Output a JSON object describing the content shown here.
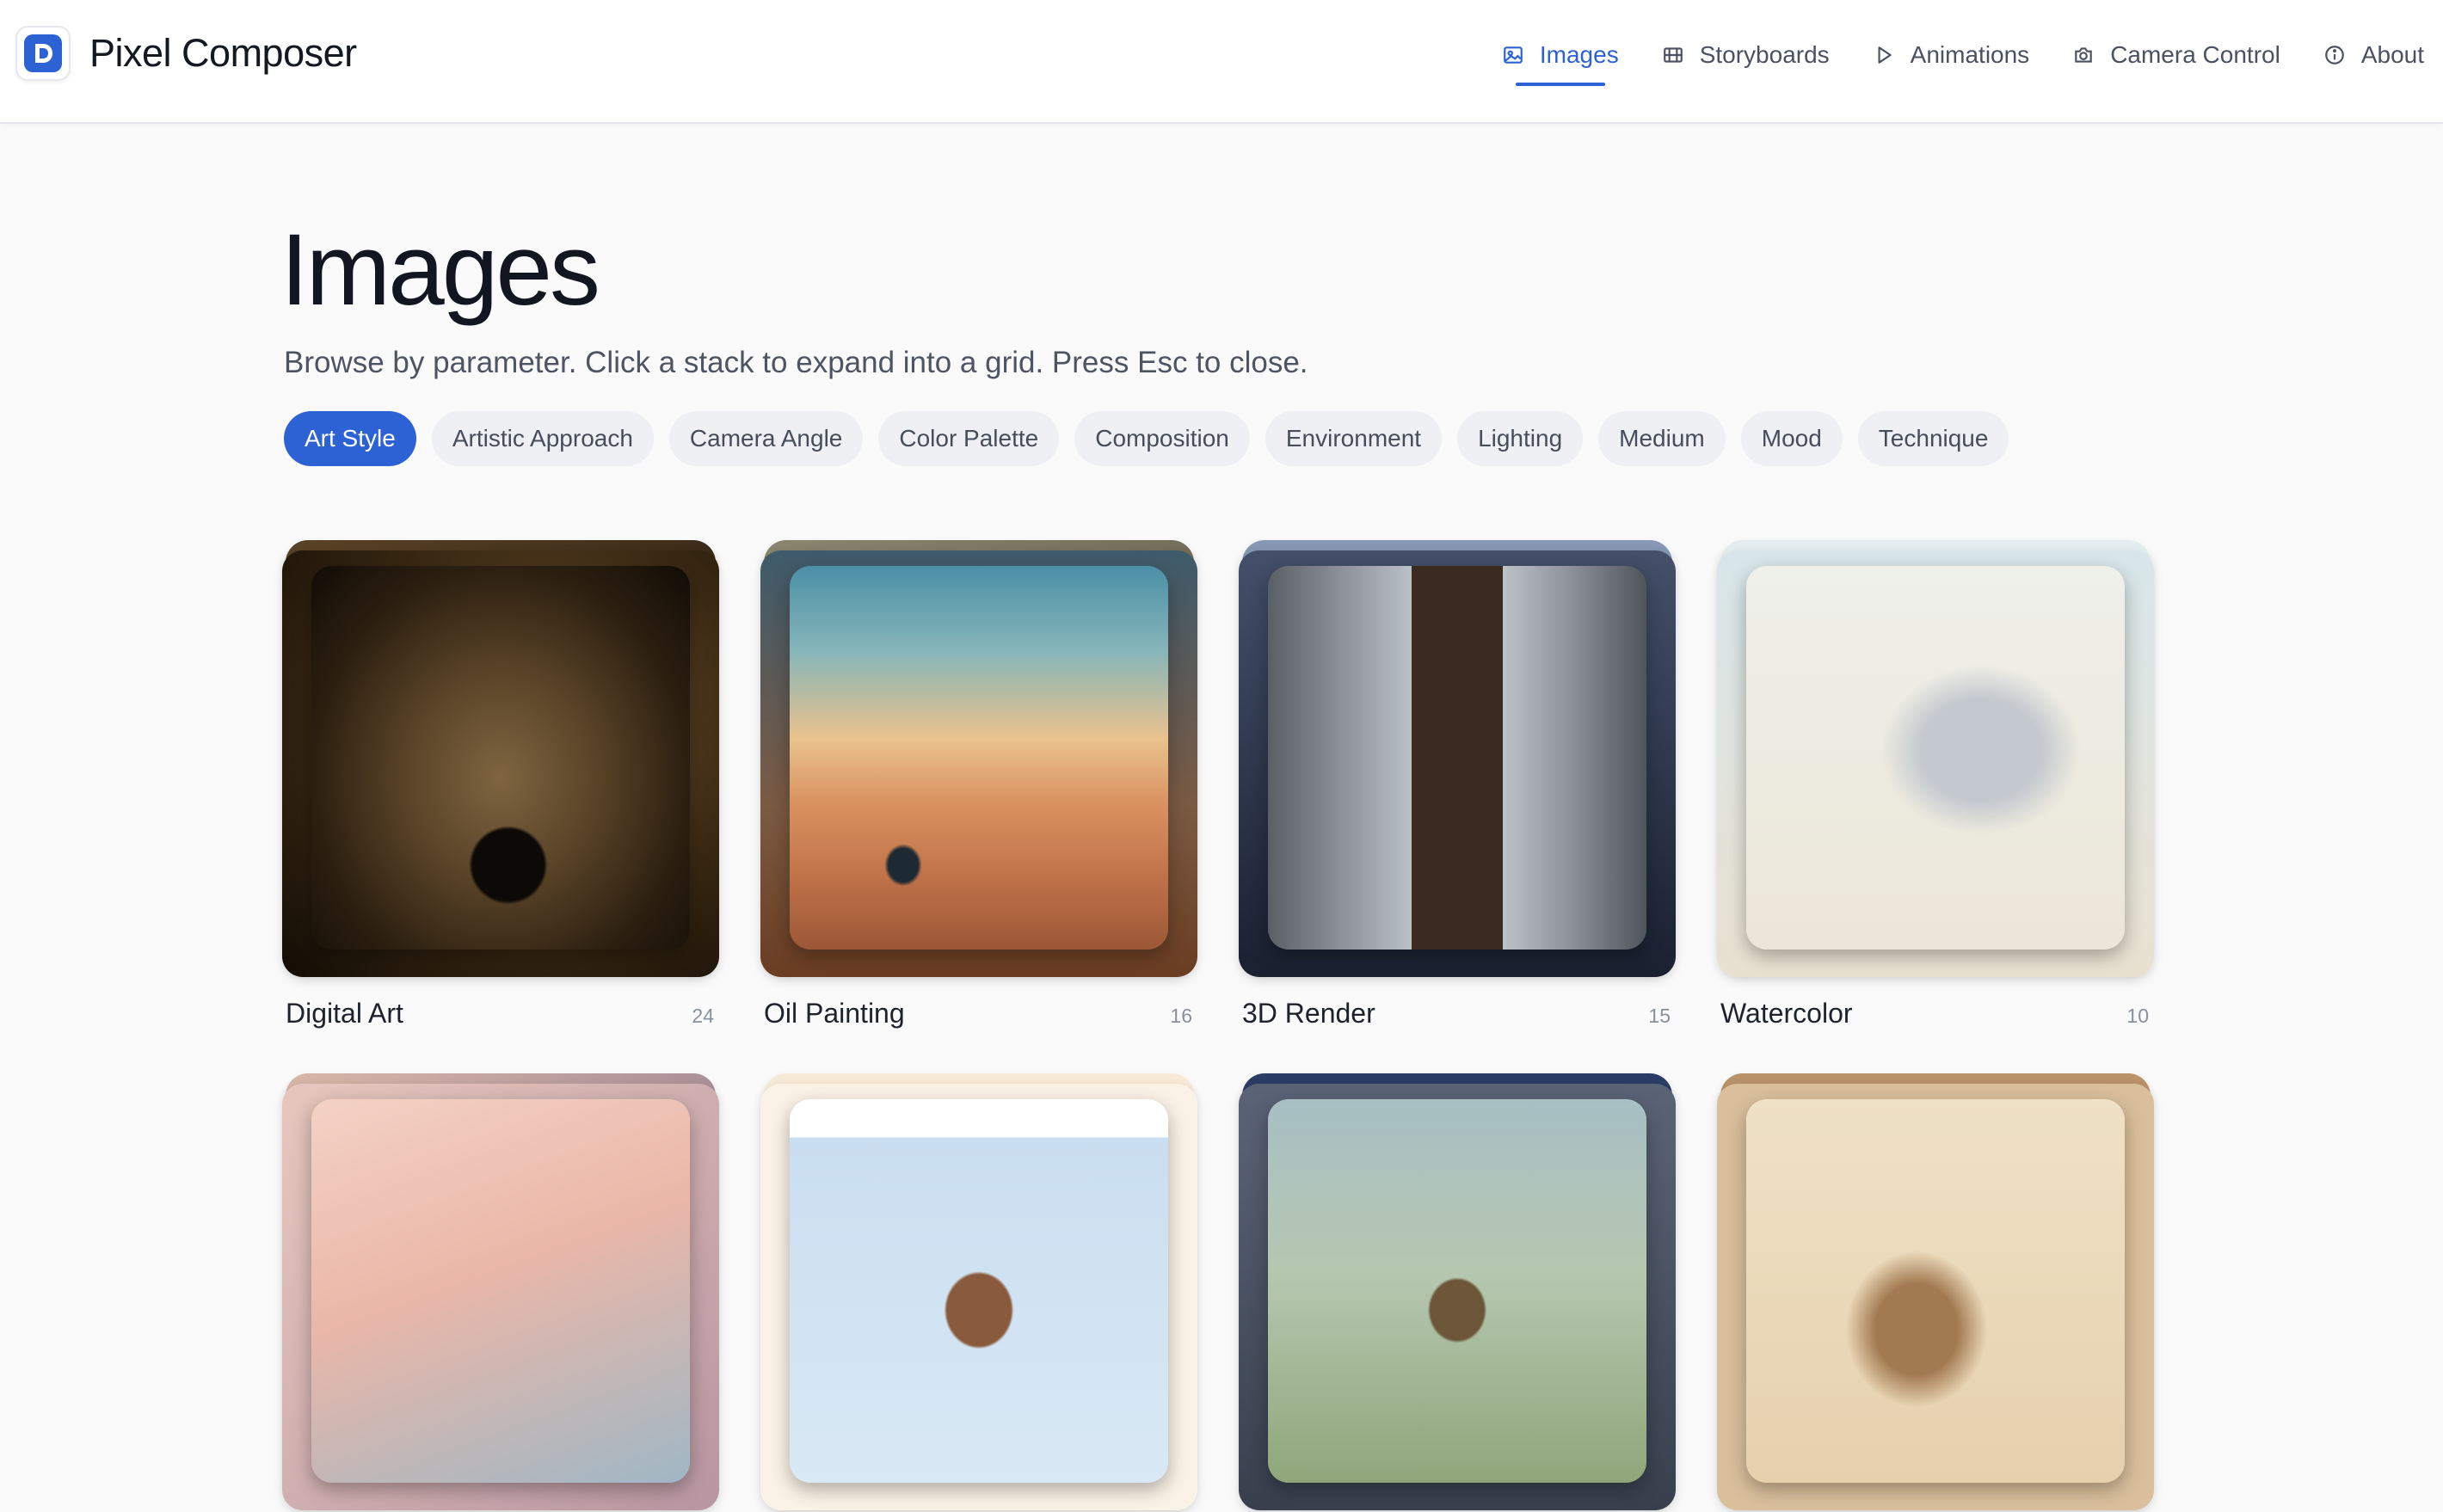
{
  "app": {
    "name": "Pixel Composer",
    "logo_icon": "logo-d-icon",
    "accent_color": "#2c62d4"
  },
  "nav": {
    "items": [
      {
        "label": "Images",
        "icon": "image-icon",
        "active": true
      },
      {
        "label": "Storyboards",
        "icon": "film-icon",
        "active": false
      },
      {
        "label": "Animations",
        "icon": "play-icon",
        "active": false
      },
      {
        "label": "Camera Control",
        "icon": "camera-icon",
        "active": false
      },
      {
        "label": "About",
        "icon": "info-icon",
        "active": false
      }
    ]
  },
  "page": {
    "title": "Images",
    "subtitle": "Browse by parameter. Click a stack to expand into a grid. Press Esc to close."
  },
  "filters": [
    {
      "label": "Art Style",
      "active": true
    },
    {
      "label": "Artistic Approach",
      "active": false
    },
    {
      "label": "Camera Angle",
      "active": false
    },
    {
      "label": "Color Palette",
      "active": false
    },
    {
      "label": "Composition",
      "active": false
    },
    {
      "label": "Environment",
      "active": false
    },
    {
      "label": "Lighting",
      "active": false
    },
    {
      "label": "Medium",
      "active": false
    },
    {
      "label": "Mood",
      "active": false
    },
    {
      "label": "Technique",
      "active": false
    }
  ],
  "stacks": [
    {
      "title": "Digital Art",
      "count": "24"
    },
    {
      "title": "Oil Painting",
      "count": "16"
    },
    {
      "title": "3D Render",
      "count": "15"
    },
    {
      "title": "Watercolor",
      "count": "10"
    }
  ]
}
